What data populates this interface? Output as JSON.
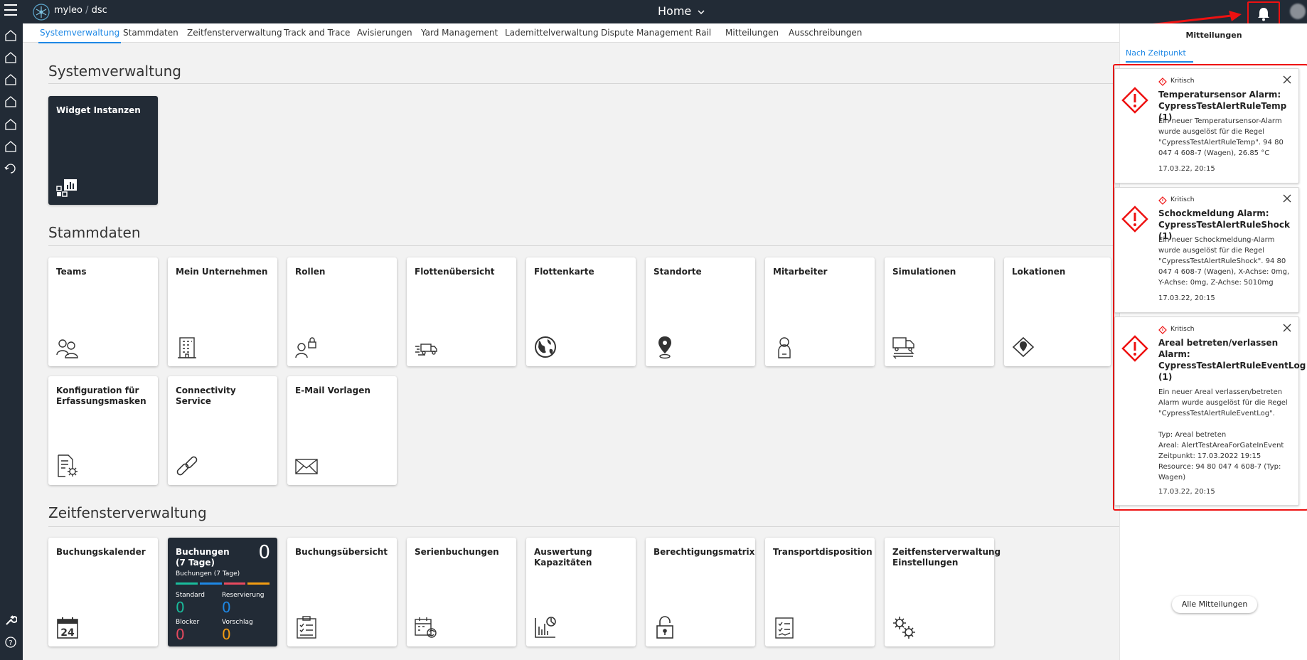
{
  "header": {
    "brand": "myleo",
    "brand_sep": "/",
    "brand_product": "dsc",
    "page_title": "Home"
  },
  "tabs": [
    {
      "label": "Systemverwaltung",
      "active": true
    },
    {
      "label": "Stammdaten"
    },
    {
      "label": "Zeitfensterverwaltung"
    },
    {
      "label": "Track and Trace"
    },
    {
      "label": "Avisierungen"
    },
    {
      "label": "Yard Management"
    },
    {
      "label": "Lademittelverwaltung"
    },
    {
      "label": "Dispute Management"
    },
    {
      "label": "Rail"
    },
    {
      "label": "Mitteilungen"
    },
    {
      "label": "Ausschreibungen"
    }
  ],
  "sections": {
    "system": {
      "title": "Systemverwaltung",
      "tiles": [
        {
          "label": "Widget Instanzen",
          "icon": "widget-icon"
        }
      ]
    },
    "stammdaten": {
      "title": "Stammdaten",
      "tiles": [
        {
          "label": "Teams",
          "icon": "teams-icon"
        },
        {
          "label": "Mein Unternehmen",
          "icon": "building-icon"
        },
        {
          "label": "Rollen",
          "icon": "role-lock-icon"
        },
        {
          "label": "Flottenübersicht",
          "icon": "fleet-icon"
        },
        {
          "label": "Flottenkarte",
          "icon": "globe-icon"
        },
        {
          "label": "Standorte",
          "icon": "location-pin-icon"
        },
        {
          "label": "Mitarbeiter",
          "icon": "employee-icon"
        },
        {
          "label": "Simulationen",
          "icon": "simulation-truck-icon"
        },
        {
          "label": "Lokationen",
          "icon": "location-diamond-icon"
        },
        {
          "label": "Konfiguration für Erfassungsmasken",
          "icon": "document-gear-icon"
        },
        {
          "label": "Connectivity Service",
          "icon": "link-icon"
        },
        {
          "label": "E-Mail Vorlagen",
          "icon": "mail-icon"
        }
      ]
    },
    "zeitfenster": {
      "title": "Zeitfensterverwaltung",
      "tiles": [
        {
          "label": "Buchungskalender",
          "icon": "calendar-icon"
        },
        {
          "label": "Buchungen (7 Tage)",
          "icon": ""
        },
        {
          "label": "Buchungsübersicht",
          "icon": "checklist-icon"
        },
        {
          "label": "Serienbuchungen",
          "icon": "calendar-repeat-icon"
        },
        {
          "label": "Auswertung Kapazitäten",
          "icon": "chart-icon"
        },
        {
          "label": "Berechtigungsmatrix",
          "icon": "padlock-icon"
        },
        {
          "label": "Transportdisposition",
          "icon": "clipboard-icon"
        },
        {
          "label": "Zeitfensterverwaltung Einstellungen",
          "icon": "gears-icon"
        }
      ]
    }
  },
  "bookings_widget": {
    "title": "Buchungen (7 Tage)",
    "total": "0",
    "subtitle": "Buchungen (7 Tage)",
    "colors": [
      "#1abc9c",
      "#1e88e5",
      "#e84a5f",
      "#f39c12"
    ],
    "standard_label": "Standard",
    "standard_value": "0",
    "reservierung_label": "Reservierung",
    "reservierung_value": "0",
    "blocker_label": "Blocker",
    "blocker_value": "0",
    "vorschlag_label": "Vorschlag",
    "vorschlag_value": "0"
  },
  "notifications": {
    "title": "Mitteilungen",
    "tab": "Nach Zeitpunkt",
    "items": [
      {
        "severity": "Kritisch",
        "title": "Temperatursensor Alarm: CypressTestAlertRuleTemp (1)",
        "body": "Ein neuer Temperatursensor-Alarm wurde ausgelöst für die Regel \"CypressTestAlertRuleTemp\". 94 80 047 4 608-7 (Wagen), 26.85 °C",
        "time": "17.03.22, 20:15"
      },
      {
        "severity": "Kritisch",
        "title": "Schockmeldung Alarm: CypressTestAlertRuleShock (1)",
        "body": "Ein neuer Schockmeldung-Alarm wurde ausgelöst für die Regel \"CypressTestAlertRuleShock\". 94 80 047 4 608-7 (Wagen), X-Achse: 0mg, Y-Achse: 0mg, Z-Achse: 5010mg",
        "time": "17.03.22, 20:15"
      },
      {
        "severity": "Kritisch",
        "title": "Areal betreten/verlassen Alarm: CypressTestAlertRuleEventLog (1)",
        "body": "Ein neuer Areal verlassen/betreten Alarm wurde ausgelöst für die Regel \"CypressTestAlertRuleEventLog\".\n\nTyp: Areal betreten\nAreal: AlertTestAreaForGateInEvent\nZeitpunkt: 17.03.2022 19:15\nResource: 94 80 047 4 608-7 (Typ: Wagen)",
        "time": "17.03.22, 20:15"
      }
    ],
    "all_button": "Alle Mitteilungen"
  },
  "colors": {
    "dark": "#222b36",
    "accent": "#1e88e5",
    "critical": "#e11"
  }
}
